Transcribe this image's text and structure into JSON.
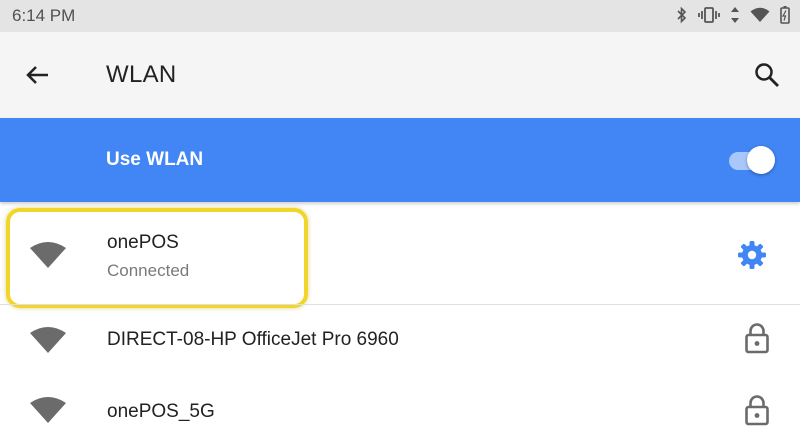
{
  "status_bar": {
    "time": "6:14 PM",
    "icons": [
      "bluetooth-icon",
      "vibrate-icon",
      "data-arrows-icon",
      "wifi-signal-icon",
      "battery-charging-icon"
    ]
  },
  "app_bar": {
    "title": "WLAN",
    "back_icon": "arrow-back-icon",
    "search_icon": "search-icon"
  },
  "master_toggle": {
    "label": "Use WLAN",
    "on": true
  },
  "networks": [
    {
      "name": "onePOS",
      "status": "Connected",
      "trailing_icon": "gear-icon",
      "highlighted": true
    },
    {
      "name": "DIRECT-08-HP OfficeJet Pro 6960",
      "trailing_icon": "lock-icon"
    },
    {
      "name": "onePOS_5G",
      "trailing_icon": "lock-icon"
    }
  ],
  "colors": {
    "accent": "#4285f4",
    "highlight": "#f0d62a",
    "icon_gray": "#6b6b6b"
  }
}
